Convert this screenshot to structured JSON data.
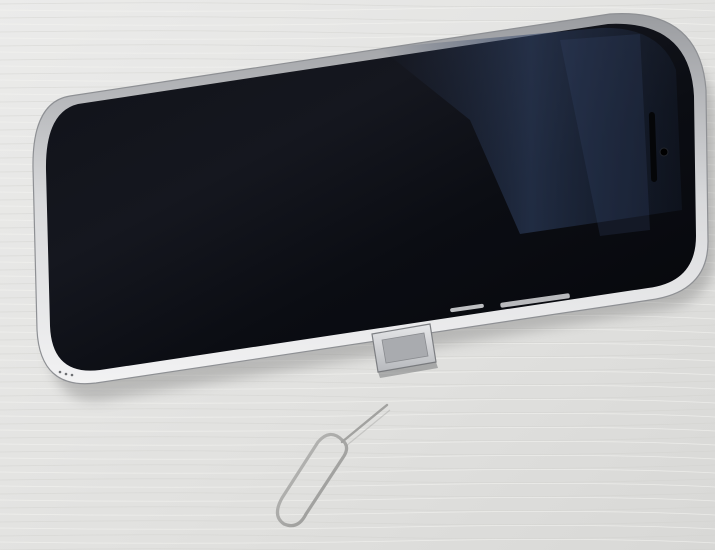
{
  "scene": {
    "background_color": "#e4e4e2",
    "phone_frame_color": "#c9cacc",
    "screen_color": "#0a0c12",
    "tray_color": "#cfd1d4",
    "tool_color": "#a9a9a7"
  },
  "objects": {
    "phone": "smartphone-face-down-screen-off",
    "sim_tray": "sim-card-tray-ejected",
    "sim_tool": "sim-eject-tool"
  }
}
